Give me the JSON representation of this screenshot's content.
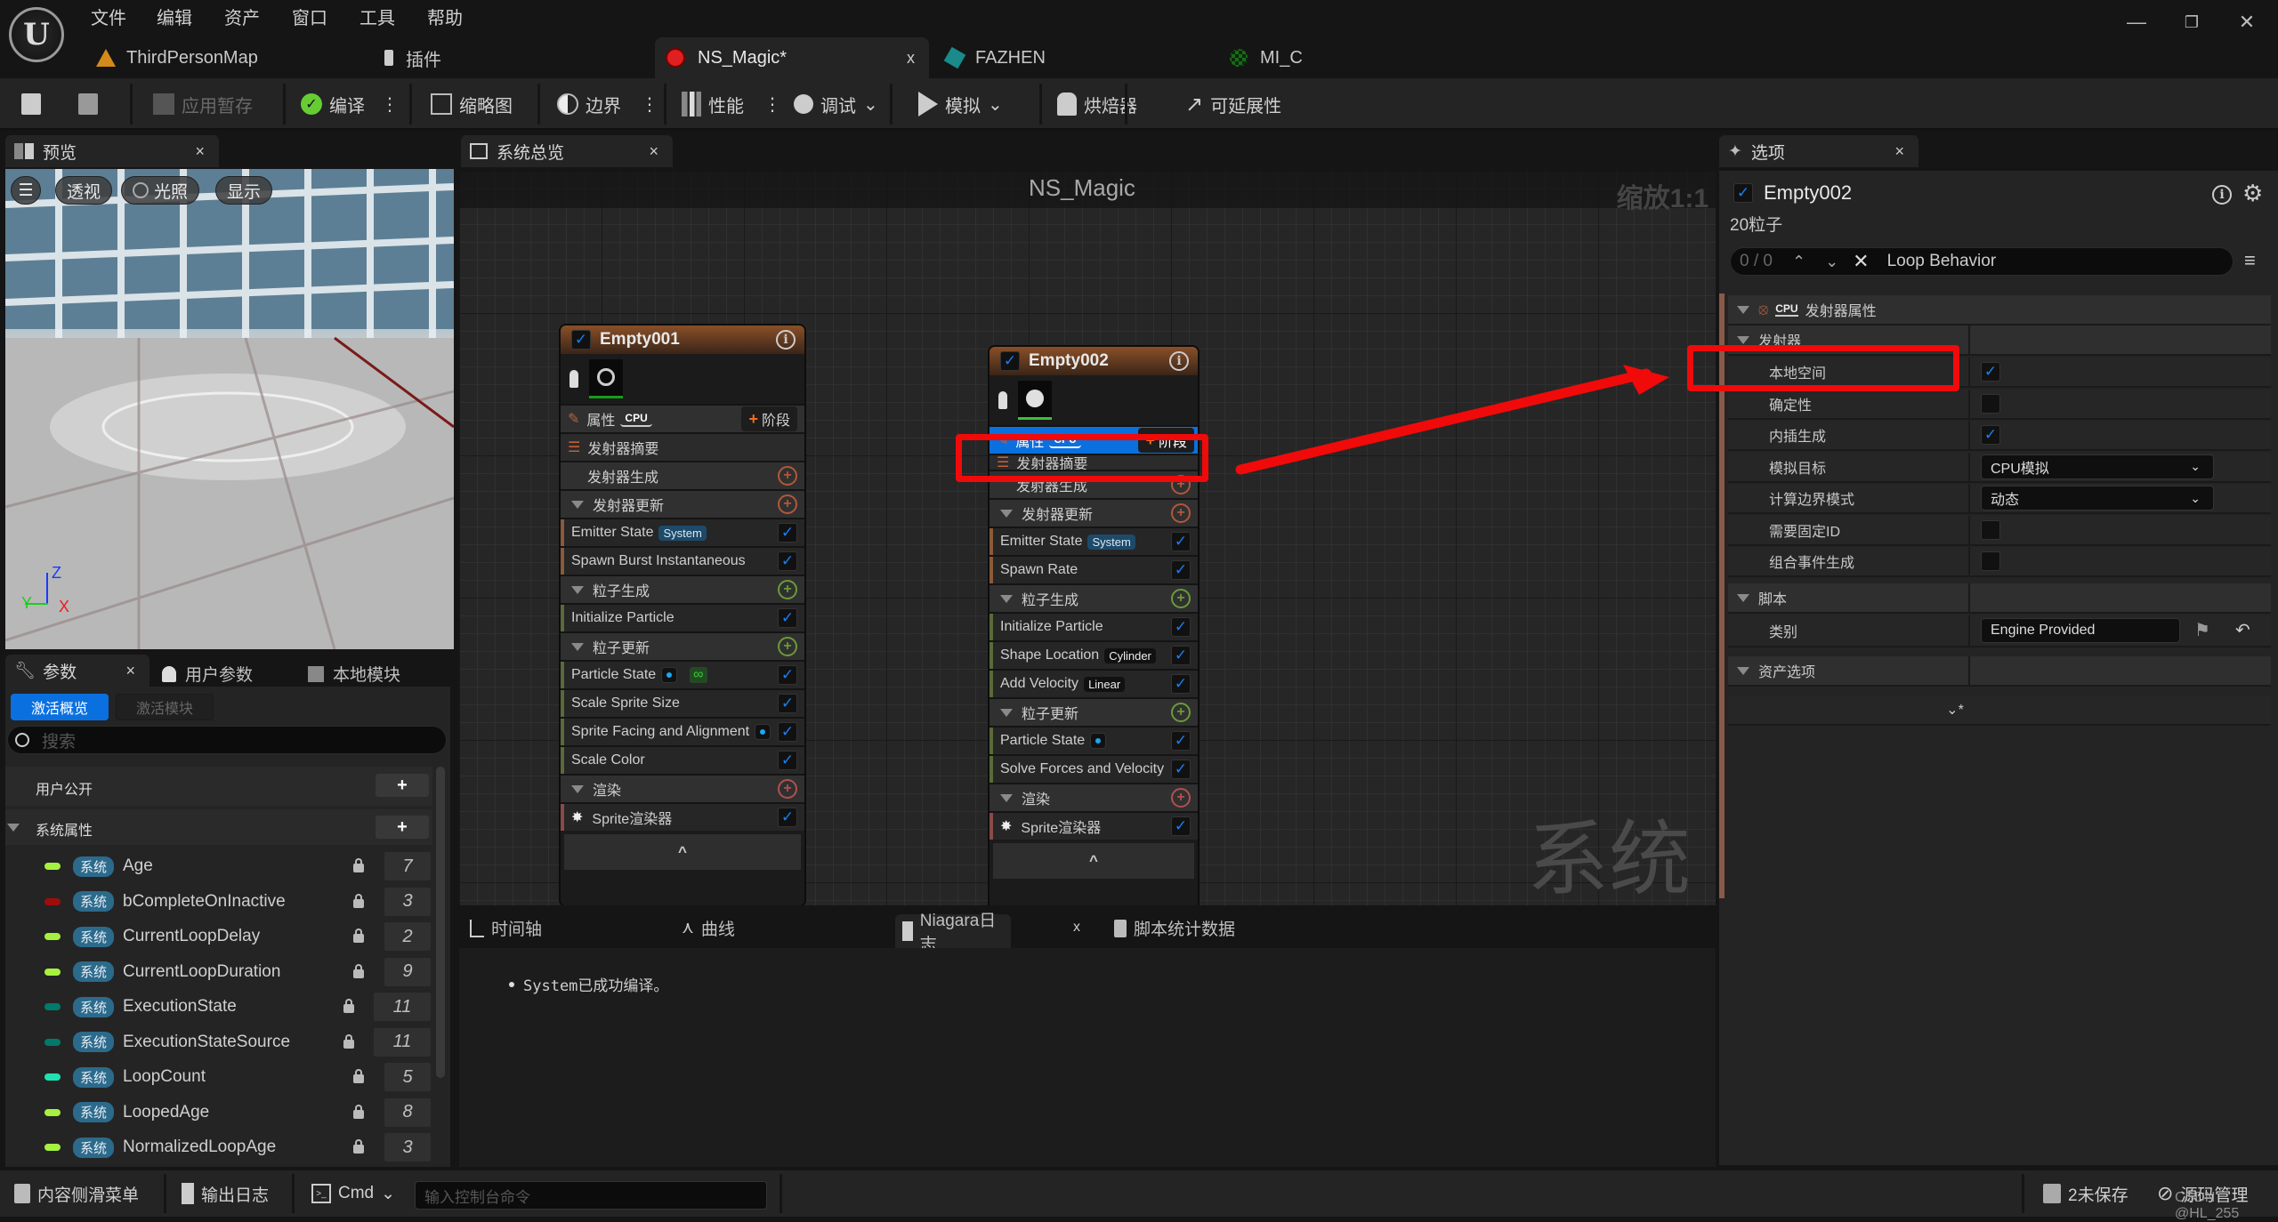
{
  "menu": [
    "文件",
    "编辑",
    "资产",
    "窗口",
    "工具",
    "帮助"
  ],
  "doc_tabs": [
    {
      "label": "ThirdPersonMap",
      "icon": "level-map-icon"
    },
    {
      "label": "插件",
      "icon": "plugin-icon"
    },
    {
      "label": "NS_Magic*",
      "icon": "niagara-system-icon",
      "active": true,
      "close": "x"
    },
    {
      "label": "FAZHEN",
      "icon": "static-mesh-icon"
    },
    {
      "label": "MI_C",
      "icon": "material-instance-icon"
    }
  ],
  "toolbar": {
    "apply_pending": "应用暂存",
    "compile": "编译",
    "thumbnail": "缩略图",
    "bounds": "边界",
    "performance": "性能",
    "debug": "调试",
    "simulate": "模拟",
    "baker": "烘焙器",
    "scalability": "可延展性"
  },
  "preview": {
    "tab_label": "预览",
    "close": "×",
    "buttons": {
      "menu": "☰",
      "perspective": "透视",
      "lighting": "光照",
      "show": "显示"
    },
    "axes": {
      "z": "Z",
      "y": "Y",
      "x": "X"
    }
  },
  "params": {
    "tabs": [
      {
        "label": "参数",
        "close": "×"
      },
      {
        "label": "用户参数"
      },
      {
        "label": "本地模块"
      }
    ],
    "toggle": {
      "active_overview": "激活概览",
      "active_modules": "激活模块"
    },
    "search_placeholder": "搜索",
    "sections": {
      "user_exposed": "用户公开",
      "system_attributes": "系统属性"
    },
    "add": "+",
    "badge": "系统",
    "items": [
      {
        "name": "Age",
        "color": "#a6f040",
        "count": "7"
      },
      {
        "name": "bCompleteOnInactive",
        "color": "#a00c0c",
        "count": "3"
      },
      {
        "name": "CurrentLoopDelay",
        "color": "#a6f040",
        "count": "2"
      },
      {
        "name": "CurrentLoopDuration",
        "color": "#a6f040",
        "count": "9"
      },
      {
        "name": "ExecutionState",
        "color": "#007a6a",
        "count": "11"
      },
      {
        "name": "ExecutionStateSource",
        "color": "#007a6a",
        "count": "11"
      },
      {
        "name": "LoopCount",
        "color": "#20e0b0",
        "count": "5"
      },
      {
        "name": "LoopedAge",
        "color": "#a6f040",
        "count": "8"
      },
      {
        "name": "NormalizedLoopAge",
        "color": "#a6f040",
        "count": "3"
      }
    ]
  },
  "graph": {
    "tab_label": "系统总览",
    "close": "×",
    "title": "NS_Magic",
    "zoom": "缩放1:1",
    "watermark": "系统",
    "common": {
      "properties": "属性",
      "cpu": "CPU",
      "stage": "阶段",
      "summary": "发射器摘要",
      "emitter_spawn": "发射器生成",
      "emitter_update": "发射器更新",
      "particle_spawn": "粒子生成",
      "particle_update": "粒子更新",
      "render": "渲染",
      "system_tag": "System",
      "sprite_renderer": "Sprite渲染器",
      "collapse": "^"
    },
    "emitter1": {
      "name": "Empty001",
      "emitter_update": [
        "Emitter State",
        "Spawn Burst Instantaneous"
      ],
      "particle_spawn": [
        "Initialize Particle"
      ],
      "particle_update": [
        "Particle State",
        "Scale Sprite Size",
        "Sprite Facing and Alignment",
        "Scale Color"
      ]
    },
    "emitter2": {
      "name": "Empty002",
      "emitter_update": [
        "Emitter State",
        "Spawn Rate"
      ],
      "particle_spawn": [
        "Initialize Particle",
        "Shape Location",
        "Add Velocity"
      ],
      "particle_spawn_tags": {
        "shape": "Cylinder",
        "velocity": "Linear"
      },
      "particle_update": [
        "Particle State",
        "Solve Forces and Velocity"
      ]
    }
  },
  "log": {
    "tabs": [
      {
        "label": "时间轴"
      },
      {
        "label": "曲线"
      },
      {
        "label": "Niagara日志",
        "close": "x"
      },
      {
        "label": "脚本统计数据"
      }
    ],
    "messages": [
      "System已成功编译。"
    ]
  },
  "details": {
    "tab_label": "选项",
    "close": "×",
    "emitter_name": "Empty002",
    "particle_count": "20粒子",
    "search": {
      "counter": "0 / 0",
      "value": "Loop Behavior"
    },
    "category": "发射器属性",
    "cpu": "CPU",
    "emitter_section": "发射器",
    "props": [
      {
        "label": "本地空间",
        "type": "checkbox",
        "checked": true
      },
      {
        "label": "确定性",
        "type": "checkbox",
        "checked": false
      },
      {
        "label": "内插生成",
        "type": "checkbox",
        "checked": true
      },
      {
        "label": "模拟目标",
        "type": "dropdown",
        "value": "CPU模拟"
      },
      {
        "label": "计算边界模式",
        "type": "dropdown",
        "value": "动态"
      },
      {
        "label": "需要固定ID",
        "type": "checkbox",
        "checked": false
      },
      {
        "label": "组合事件生成",
        "type": "checkbox",
        "checked": false
      }
    ],
    "script_section": "脚本",
    "category_label": "类别",
    "category_value": "Engine Provided",
    "asset_section": "资产选项",
    "advanced": "⌄*"
  },
  "statusbar": {
    "content_drawer": "内容侧滑菜单",
    "output_log": "输出日志",
    "cmd": "Cmd",
    "console_placeholder": "输入控制台命令",
    "unsaved": "2未保存",
    "source_control": "源码管理",
    "watermark": "CSDN @HL_255"
  }
}
